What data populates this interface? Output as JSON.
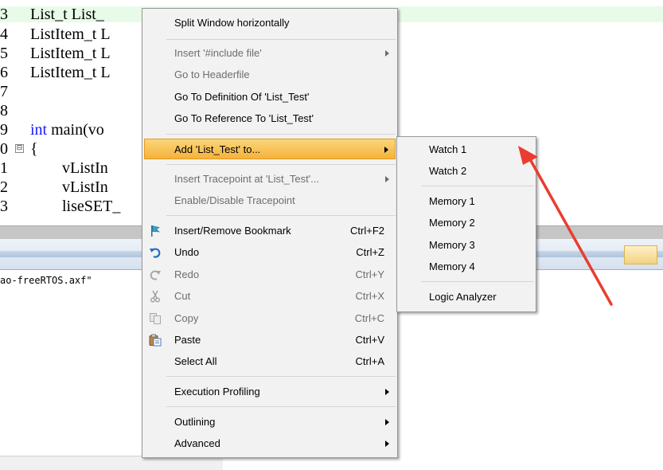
{
  "editor": {
    "lines": [
      {
        "num": "3",
        "text": "List_t List_"
      },
      {
        "num": "4",
        "text": "ListItem_t L"
      },
      {
        "num": "5",
        "text": "ListItem_t L"
      },
      {
        "num": "6",
        "text": "ListItem_t L"
      },
      {
        "num": "7",
        "text": ""
      },
      {
        "num": "8",
        "text": ""
      },
      {
        "num": "9",
        "keyword": "int",
        "text": " main(vo"
      },
      {
        "num": "0",
        "fold": "⊟",
        "text": "{"
      },
      {
        "num": "1",
        "text": "        vListIn"
      },
      {
        "num": "2",
        "text": "        vListIn"
      },
      {
        "num": "3",
        "text": "        liseSET_"
      }
    ]
  },
  "output": {
    "text": "ao-freeRTOS.axf\""
  },
  "context_menu": {
    "items": [
      {
        "label": "Split Window horizontally"
      },
      {
        "label": "Insert '#include file'",
        "disabled": true,
        "submenu": true
      },
      {
        "label": "Go to Headerfile",
        "disabled": true
      },
      {
        "label": "Go To Definition Of 'List_Test'"
      },
      {
        "label": "Go To Reference To 'List_Test'"
      },
      {
        "label": "Add 'List_Test' to...",
        "submenu": true,
        "highlighted": true
      },
      {
        "label": "Insert Tracepoint at 'List_Test'...",
        "disabled": true,
        "submenu": true
      },
      {
        "label": "Enable/Disable Tracepoint",
        "disabled": true
      },
      {
        "label": "Insert/Remove Bookmark",
        "shortcut": "Ctrl+F2",
        "icon": "bookmark-flag-icon"
      },
      {
        "label": "Undo",
        "shortcut": "Ctrl+Z",
        "icon": "undo-icon"
      },
      {
        "label": "Redo",
        "shortcut": "Ctrl+Y",
        "icon": "redo-icon",
        "disabled": true
      },
      {
        "label": "Cut",
        "shortcut": "Ctrl+X",
        "icon": "scissors-icon",
        "disabled": true
      },
      {
        "label": "Copy",
        "shortcut": "Ctrl+C",
        "icon": "copy-icon",
        "disabled": true
      },
      {
        "label": "Paste",
        "shortcut": "Ctrl+V",
        "icon": "clipboard-paste-icon"
      },
      {
        "label": "Select All",
        "shortcut": "Ctrl+A"
      },
      {
        "label": "Execution Profiling",
        "submenu": true
      },
      {
        "label": "Outlining",
        "submenu": true
      },
      {
        "label": "Advanced",
        "submenu": true
      }
    ]
  },
  "submenu": {
    "items": [
      {
        "label": "Watch 1"
      },
      {
        "label": "Watch 2"
      },
      {
        "label": "Memory 1"
      },
      {
        "label": "Memory 2"
      },
      {
        "label": "Memory 3"
      },
      {
        "label": "Memory 4"
      },
      {
        "label": "Logic Analyzer"
      }
    ]
  },
  "colors": {
    "highlight": "#f4b23c",
    "annotation_arrow": "#ec3b2f",
    "keyword": "#1a1aff",
    "current_line": "#e8fbe8"
  }
}
